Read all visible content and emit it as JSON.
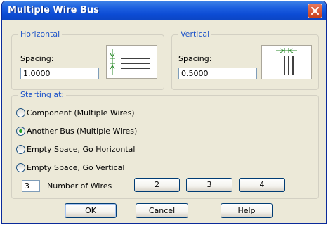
{
  "window": {
    "title": "Multiple Wire Bus"
  },
  "horizontal": {
    "legend": "Horizontal",
    "spacing_label": "Spacing:",
    "spacing_value": "1.0000"
  },
  "vertical": {
    "legend": "Vertical",
    "spacing_label": "Spacing:",
    "spacing_value": "0.5000"
  },
  "starting": {
    "legend": "Starting at:",
    "options": [
      {
        "label": "Component (Multiple Wires)",
        "selected": false
      },
      {
        "label": "Another Bus (Multiple Wires)",
        "selected": true
      },
      {
        "label": "Empty Space, Go Horizontal",
        "selected": false
      },
      {
        "label": "Empty Space, Go Vertical",
        "selected": false
      }
    ],
    "wires_value": "3",
    "wires_label": "Number of Wires",
    "quick_buttons": [
      "2",
      "3",
      "4"
    ]
  },
  "buttons": {
    "ok": "OK",
    "cancel": "Cancel",
    "help": "Help"
  },
  "icons": {
    "close": "close-icon"
  },
  "colors": {
    "title_bar": "#0c4bd4",
    "legend_text": "#1d53c8",
    "radio_selected": "#21a121",
    "dialog_bg": "#ece9d8"
  }
}
